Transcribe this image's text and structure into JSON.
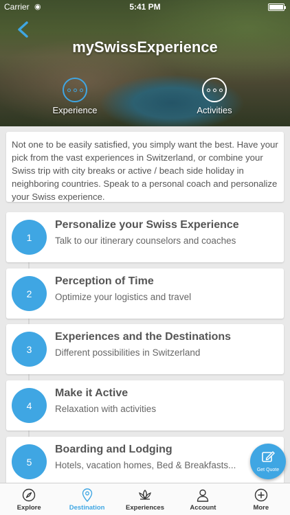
{
  "status_bar": {
    "carrier": "Carrier",
    "time": "5:41 PM",
    "wifi_icon": "wifi-icon",
    "battery_icon": "battery-icon"
  },
  "header": {
    "back_icon": "chevron-left-icon",
    "title": "mySwissExperience",
    "tabs": [
      {
        "label": "Experience",
        "icon": "dots-circle-icon",
        "active": true
      },
      {
        "label": "Activities",
        "icon": "dots-circle-icon",
        "active": false
      }
    ]
  },
  "intro": {
    "text": "Not one to be easily satisfied, you simply want the best. Have your pick from the vast experiences in Switzerland, or combine your Swiss trip with city breaks or active / beach side holiday in neighboring countries. Speak to a personal coach and personalize your Swiss experience."
  },
  "steps": [
    {
      "number": "1",
      "title": "Personalize your Swiss Experience",
      "subtitle": "Talk to our itinerary counselors and coaches"
    },
    {
      "number": "2",
      "title": "Perception of Time",
      "subtitle": "Optimize your logistics and travel"
    },
    {
      "number": "3",
      "title": "Experiences and the Destinations",
      "subtitle": "Different possibilities in Switzerland"
    },
    {
      "number": "4",
      "title": "Make it Active",
      "subtitle": "Relaxation with activities"
    },
    {
      "number": "5",
      "title": "Boarding and Lodging",
      "subtitle": "Hotels, vacation homes, Bed & Breakfasts..."
    }
  ],
  "fab": {
    "label": "Get Quote",
    "icon": "edit-icon"
  },
  "bottom_nav": [
    {
      "label": "Explore",
      "icon": "compass-icon",
      "active": false
    },
    {
      "label": "Destination",
      "icon": "map-pin-icon",
      "active": true
    },
    {
      "label": "Experiences",
      "icon": "lotus-icon",
      "active": false
    },
    {
      "label": "Account",
      "icon": "user-icon",
      "active": false
    },
    {
      "label": "More",
      "icon": "plus-circle-icon",
      "active": false
    }
  ],
  "colors": {
    "accent": "#3fa6e3",
    "text": "#555555",
    "background": "#e9e9e9"
  }
}
